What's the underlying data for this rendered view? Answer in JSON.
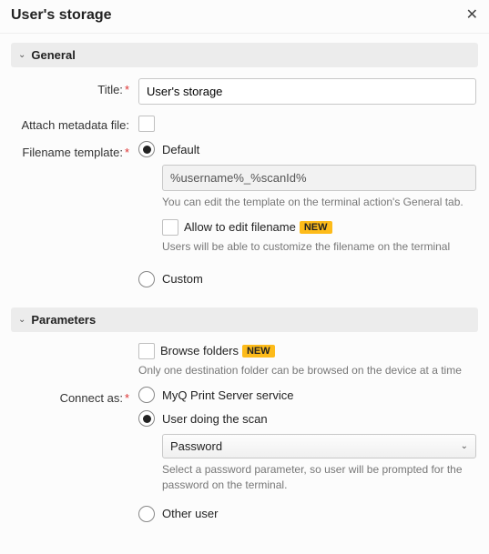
{
  "dialog": {
    "title": "User's storage"
  },
  "sections": {
    "general": "General",
    "parameters": "Parameters"
  },
  "general": {
    "title_label": "Title:",
    "title_value": "User's storage",
    "attach_label": "Attach metadata file:",
    "filename_template_label": "Filename template:",
    "default_option": "Default",
    "default_template": "%username%_%scanId%",
    "default_hint": "You can edit the template on the terminal action's General tab.",
    "allow_edit_label": "Allow to edit filename",
    "allow_edit_hint": "Users will be able to customize the filename on the terminal",
    "custom_option": "Custom"
  },
  "parameters": {
    "browse_folders_label": "Browse folders",
    "browse_hint": "Only one destination folder can be browsed on the device at a time",
    "connect_as_label": "Connect as:",
    "service_option": "MyQ Print Server service",
    "user_scan_option": "User doing the scan",
    "password_select": "Password",
    "password_hint": "Select a password parameter, so user will be prompted for the password on the terminal.",
    "other_user_option": "Other user"
  },
  "badges": {
    "new": "NEW"
  }
}
